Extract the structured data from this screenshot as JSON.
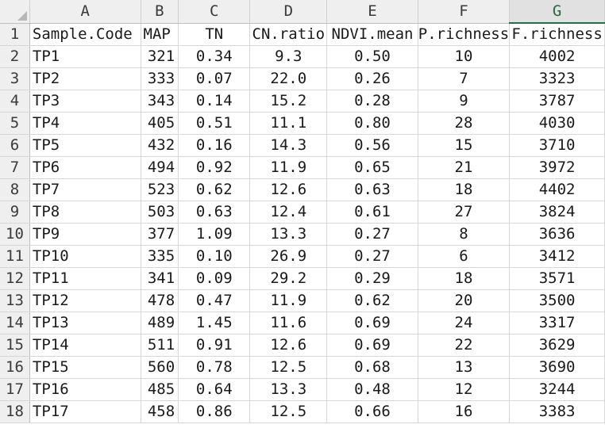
{
  "columns": [
    "A",
    "B",
    "C",
    "D",
    "E",
    "F",
    "G"
  ],
  "selected_column": "G",
  "rows": [
    {
      "n": "1",
      "cells": [
        "Sample.Code",
        "MAP",
        "TN",
        "CN.ratio",
        "NDVI.mean",
        "P.richness",
        "F.richness"
      ]
    },
    {
      "n": "2",
      "cells": [
        "TP1",
        "321",
        "0.34",
        "9.3",
        "0.50",
        "10",
        "4002"
      ]
    },
    {
      "n": "3",
      "cells": [
        "TP2",
        "333",
        "0.07",
        "22.0",
        "0.26",
        "7",
        "3323"
      ]
    },
    {
      "n": "4",
      "cells": [
        "TP3",
        "343",
        "0.14",
        "15.2",
        "0.28",
        "9",
        "3787"
      ]
    },
    {
      "n": "5",
      "cells": [
        "TP4",
        "405",
        "0.51",
        "11.1",
        "0.80",
        "28",
        "4030"
      ]
    },
    {
      "n": "6",
      "cells": [
        "TP5",
        "432",
        "0.16",
        "14.3",
        "0.56",
        "15",
        "3710"
      ]
    },
    {
      "n": "7",
      "cells": [
        "TP6",
        "494",
        "0.92",
        "11.9",
        "0.65",
        "21",
        "3972"
      ]
    },
    {
      "n": "8",
      "cells": [
        "TP7",
        "523",
        "0.62",
        "12.6",
        "0.63",
        "18",
        "4402"
      ]
    },
    {
      "n": "9",
      "cells": [
        "TP8",
        "503",
        "0.63",
        "12.4",
        "0.61",
        "27",
        "3824"
      ]
    },
    {
      "n": "10",
      "cells": [
        "TP9",
        "377",
        "1.09",
        "13.3",
        "0.27",
        "8",
        "3636"
      ]
    },
    {
      "n": "11",
      "cells": [
        "TP10",
        "335",
        "0.10",
        "26.9",
        "0.27",
        "6",
        "3412"
      ]
    },
    {
      "n": "12",
      "cells": [
        "TP11",
        "341",
        "0.09",
        "29.2",
        "0.29",
        "18",
        "3571"
      ]
    },
    {
      "n": "13",
      "cells": [
        "TP12",
        "478",
        "0.47",
        "11.9",
        "0.62",
        "20",
        "3500"
      ]
    },
    {
      "n": "14",
      "cells": [
        "TP13",
        "489",
        "1.45",
        "11.6",
        "0.69",
        "24",
        "3317"
      ]
    },
    {
      "n": "15",
      "cells": [
        "TP14",
        "511",
        "0.91",
        "12.6",
        "0.69",
        "22",
        "3629"
      ]
    },
    {
      "n": "16",
      "cells": [
        "TP15",
        "560",
        "0.78",
        "12.5",
        "0.68",
        "13",
        "3690"
      ]
    },
    {
      "n": "17",
      "cells": [
        "TP16",
        "485",
        "0.64",
        "13.3",
        "0.48",
        "12",
        "3244"
      ]
    },
    {
      "n": "18",
      "cells": [
        "TP17",
        "458",
        "0.86",
        "12.5",
        "0.66",
        "16",
        "3383"
      ]
    }
  ],
  "colors": {
    "header_bg": "#efefef",
    "selected_accent": "#217346",
    "gridline": "#d6d6d6"
  }
}
